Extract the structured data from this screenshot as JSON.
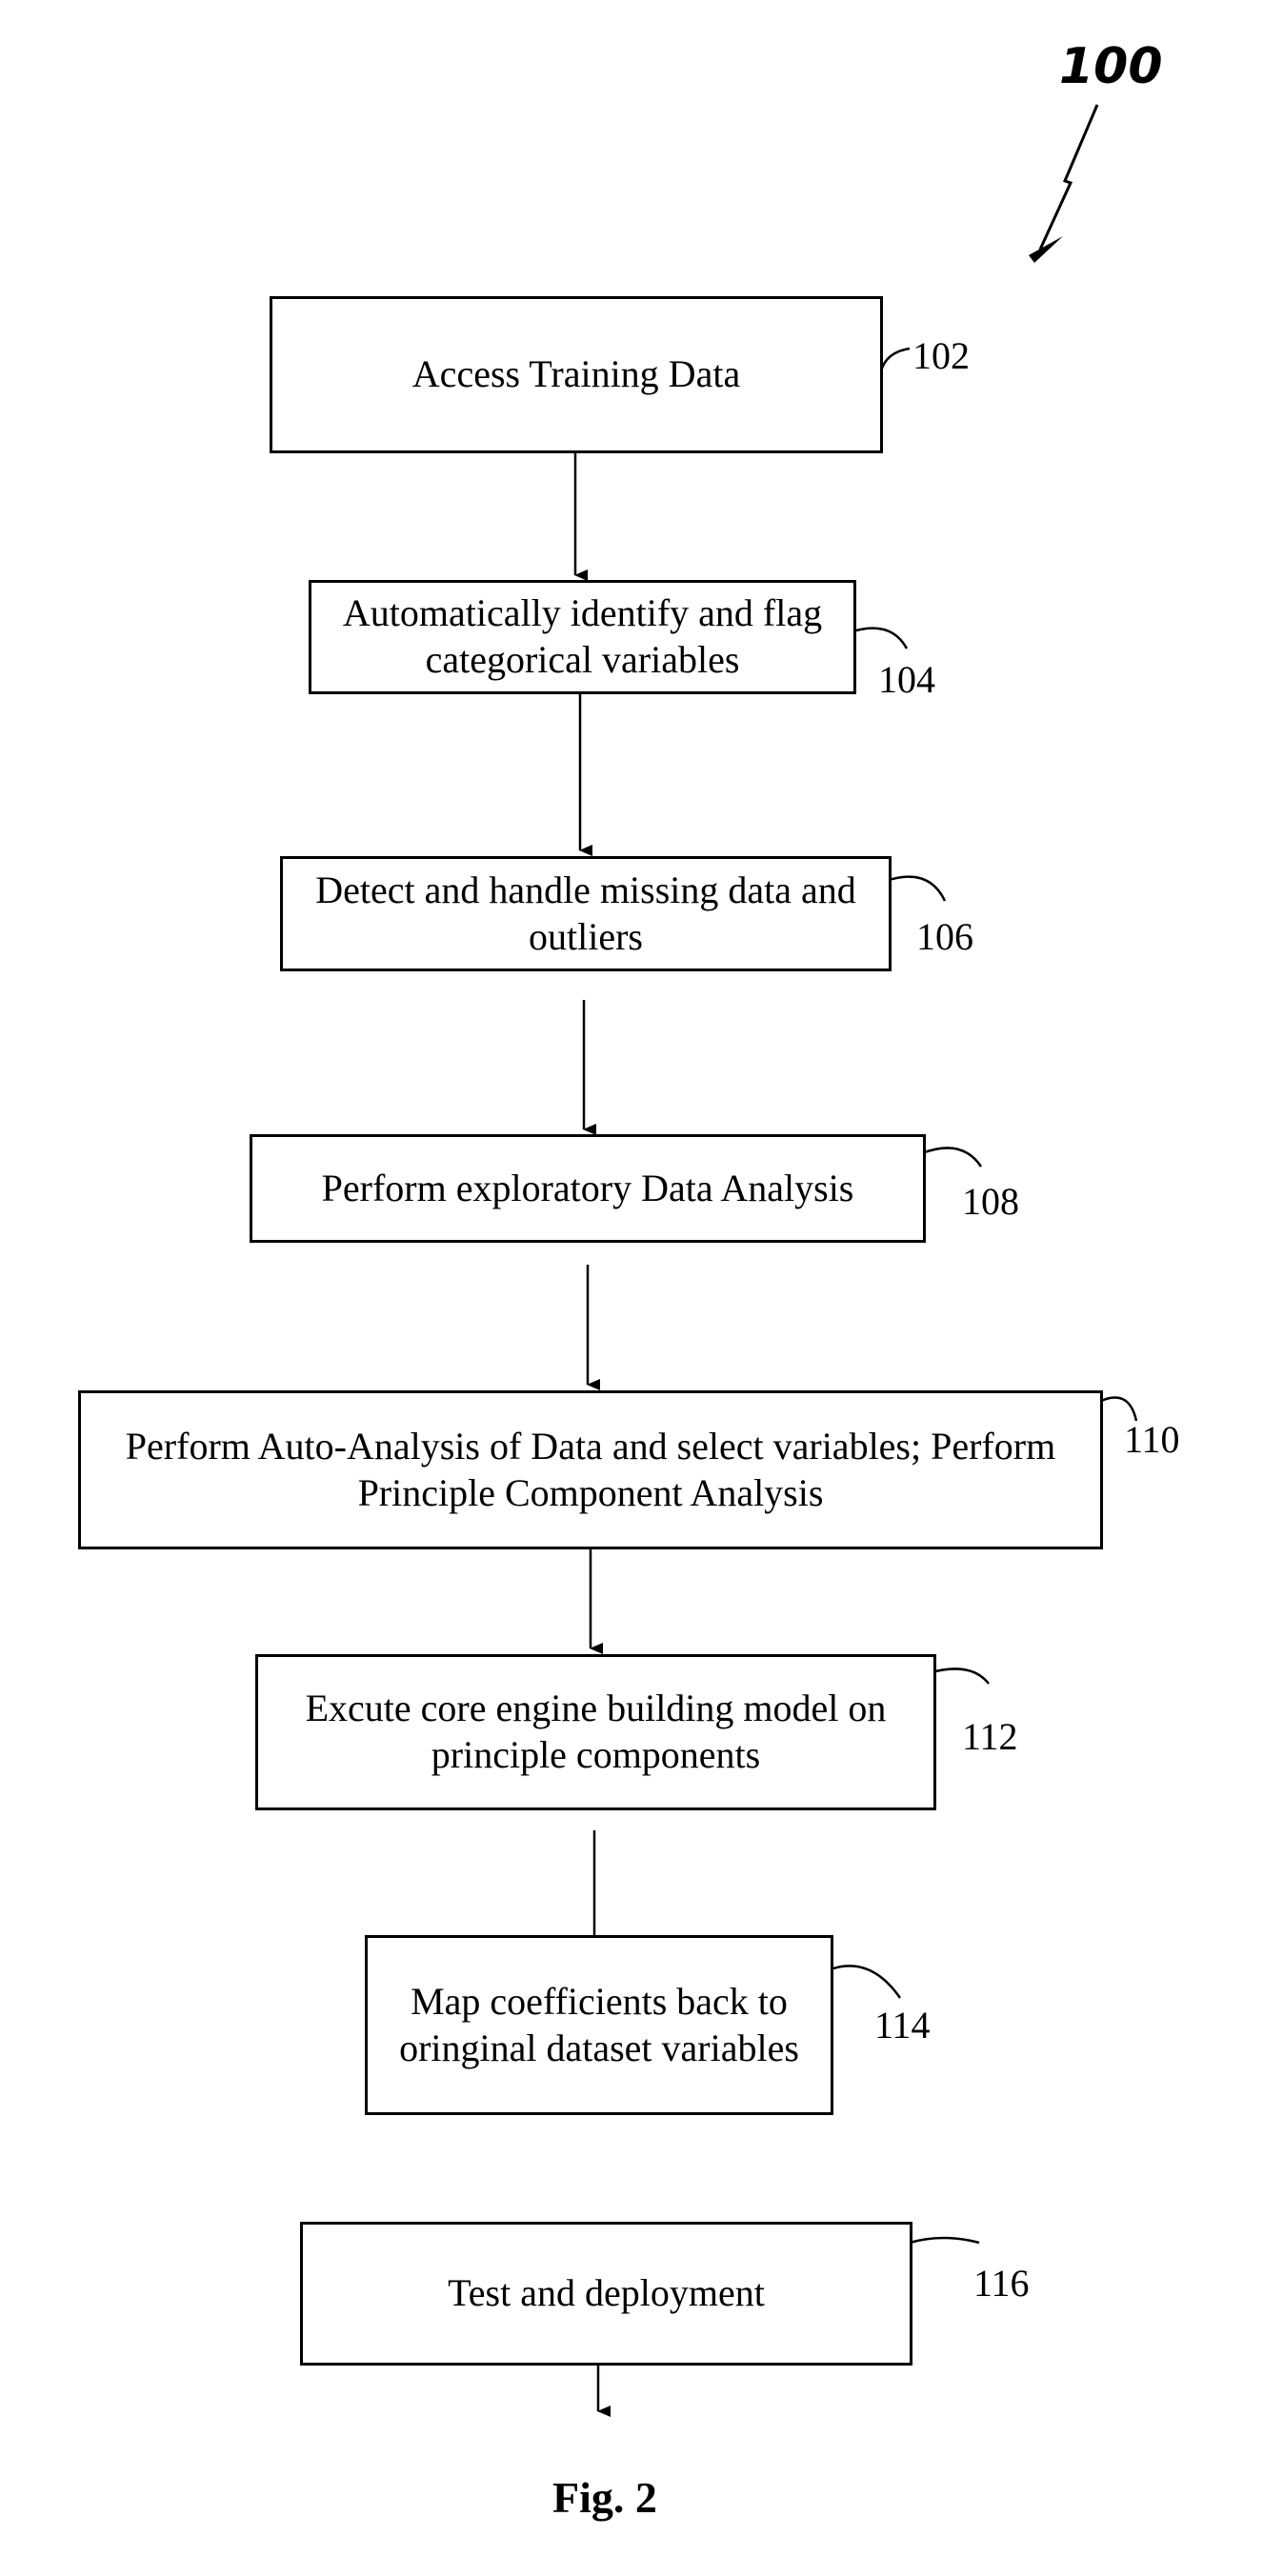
{
  "figure_number_label": "100",
  "caption": "Fig. 2",
  "steps": [
    {
      "ref": "102",
      "text": "Access Training Data"
    },
    {
      "ref": "104",
      "text": "Automatically identify and flag categorical variables"
    },
    {
      "ref": "106",
      "text": "Detect and handle missing data and outliers"
    },
    {
      "ref": "108",
      "text": "Perform exploratory Data Analysis"
    },
    {
      "ref": "110",
      "text": "Perform Auto-Analysis of Data and select variables; Perform Principle Component Analysis"
    },
    {
      "ref": "112",
      "text": "Excute core engine building model on principle components"
    },
    {
      "ref": "114",
      "text": "Map coefficients back to oringinal dataset variables"
    },
    {
      "ref": "116",
      "text": "Test and deployment"
    }
  ]
}
